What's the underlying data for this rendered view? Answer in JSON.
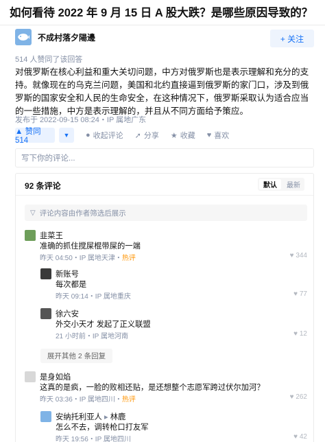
{
  "question": {
    "title": "如何看待 2022 年 9 月 15 日 A 股大跌？是哪些原因导致的？"
  },
  "author": {
    "name": "不成村落夕陽邊",
    "follow_label": "+ 关注"
  },
  "answer": {
    "votes_text": "514 人赞同了该回答",
    "content": "对俄罗斯在核心利益和重大关切问题，中方对俄罗斯也是表示理解和充分的支持。就像现在的乌克兰问题，美国和北约直接逼到俄罗斯的家门口，涉及到俄罗斯的国家安全和人民的生命安全，在这种情况下，俄罗斯采取认为适合应当的一些措施，中方是表示理解的，并且从不同方面给予策应。",
    "publish_time": "发布于 2022-09-15 08:24・IP 属地广东"
  },
  "actions": {
    "vote_up": "▲ 赞同 514",
    "vote_down": "▼",
    "comment": "收起评论",
    "share": "分享",
    "favorite": "收藏",
    "like": "喜欢"
  },
  "comment_input": {
    "placeholder": "写下你的评论..."
  },
  "comments": {
    "count_label": "92 条评论",
    "sort": {
      "default": "默认",
      "latest": "最新"
    },
    "filter_notice": "评论内容由作者筛选后展示",
    "expand_label": "展开其他 2 条回复",
    "items": [
      {
        "name": "韭菜王",
        "text": "准确的抓住搅屎棍带屎的一端",
        "time_ip": "昨天 04:50・IP 属地天津・",
        "hot": "热评",
        "likes": "344"
      },
      {
        "name": "新账号",
        "text": "每次都是",
        "time_ip": "昨天 09:14・IP 属地重庆",
        "likes": "77"
      },
      {
        "name": "徐六安",
        "text": "外交小天才 发起了正义联盟",
        "time_ip": "21 小时前・IP 属地河南",
        "likes": "12"
      },
      {
        "name": "是身如焰",
        "text": "这真的是疯，一脸的败相还贴，是还想整个志愿军跨过伏尔加河？",
        "time_ip": "昨天 03:36・IP 属地四川・",
        "hot": "热评",
        "likes": "262"
      },
      {
        "name": "安纳托利亚人",
        "reply_to": "林鹿",
        "text": "怎么不去，调转枪口打友军",
        "time_ip": "昨天 19:56・IP 属地四川",
        "likes": "42"
      }
    ]
  },
  "colors": {
    "accent": "#1772f6",
    "hot": "#ff9607",
    "muted": "#8590a6"
  }
}
